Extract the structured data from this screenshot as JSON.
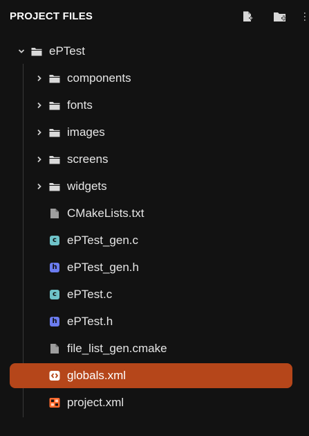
{
  "header": {
    "title": "PROJECT FILES"
  },
  "colors": {
    "background": "#121212",
    "selected_row": "#b5461a",
    "c_file_badge": "#6fc3c9",
    "h_file_badge": "#6b7cf0",
    "xml_icon": "#ff6a2e",
    "folder_icon": "#d9d9d9"
  },
  "tree": {
    "root": {
      "label": "ePTest",
      "icon": "folder-icon",
      "expanded": true
    },
    "items": [
      {
        "label": "components",
        "icon": "folder-icon",
        "type": "folder"
      },
      {
        "label": "fonts",
        "icon": "folder-icon",
        "type": "folder"
      },
      {
        "label": "images",
        "icon": "folder-icon",
        "type": "folder"
      },
      {
        "label": "screens",
        "icon": "folder-icon",
        "type": "folder"
      },
      {
        "label": "widgets",
        "icon": "folder-icon",
        "type": "folder"
      },
      {
        "label": "CMakeLists.txt",
        "icon": "file-icon",
        "type": "file"
      },
      {
        "label": "ePTest_gen.c",
        "icon": "c-file-icon",
        "type": "file",
        "badge": "c"
      },
      {
        "label": "ePTest_gen.h",
        "icon": "h-file-icon",
        "type": "file",
        "badge": "h"
      },
      {
        "label": "ePTest.c",
        "icon": "c-file-icon",
        "type": "file",
        "badge": "c"
      },
      {
        "label": "ePTest.h",
        "icon": "h-file-icon",
        "type": "file",
        "badge": "h"
      },
      {
        "label": "file_list_gen.cmake",
        "icon": "file-icon",
        "type": "file"
      },
      {
        "label": "globals.xml",
        "icon": "xml-icon",
        "type": "file",
        "selected": true
      },
      {
        "label": "project.xml",
        "icon": "project-xml-icon",
        "type": "file"
      }
    ]
  }
}
